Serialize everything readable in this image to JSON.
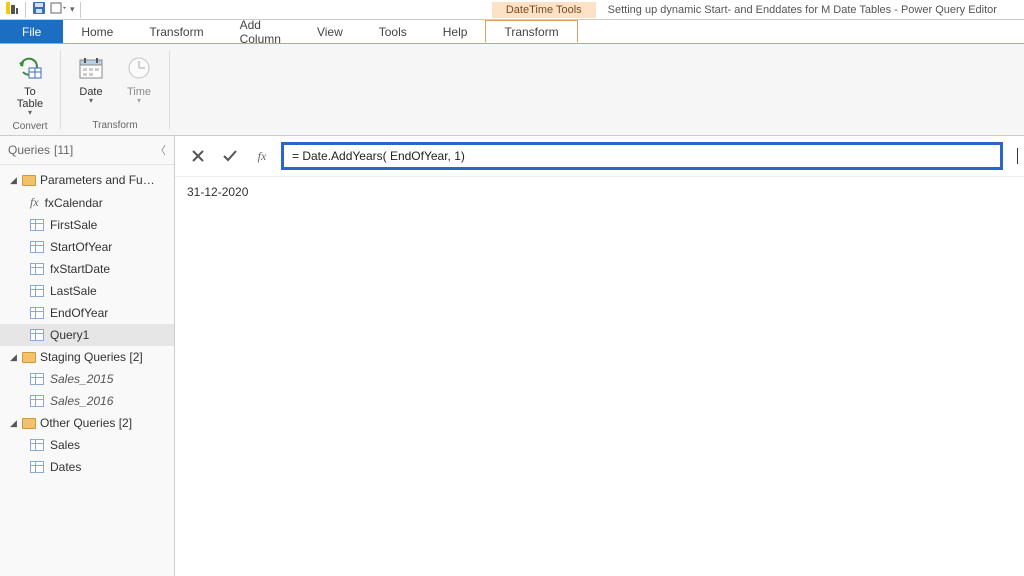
{
  "titlebar": {
    "context_label": "DateTime Tools",
    "document_title": "Setting up dynamic Start- and Enddates for M Date Tables - Power Query Editor"
  },
  "ribbon": {
    "tabs": {
      "file": "File",
      "home": "Home",
      "transform": "Transform",
      "add_column": "Add Column",
      "view": "View",
      "tools": "Tools",
      "help": "Help",
      "context_transform": "Transform"
    },
    "groups": {
      "convert": {
        "label": "Convert",
        "to_table": "To\nTable"
      },
      "transform": {
        "label": "Transform",
        "date": "Date",
        "time": "Time"
      }
    }
  },
  "queries": {
    "header": "Queries",
    "count": "[11]",
    "groups": [
      {
        "name": "Parameters and Fu…",
        "items": [
          {
            "label": "fxCalendar",
            "kind": "fx"
          },
          {
            "label": "FirstSale",
            "kind": "table"
          },
          {
            "label": "StartOfYear",
            "kind": "table"
          },
          {
            "label": "fxStartDate",
            "kind": "table"
          },
          {
            "label": "LastSale",
            "kind": "table"
          },
          {
            "label": "EndOfYear",
            "kind": "table"
          },
          {
            "label": "Query1",
            "kind": "table",
            "selected": true
          }
        ]
      },
      {
        "name": "Staging Queries [2]",
        "items": [
          {
            "label": "Sales_2015",
            "kind": "table",
            "italic": true
          },
          {
            "label": "Sales_2016",
            "kind": "table",
            "italic": true
          }
        ]
      },
      {
        "name": "Other Queries [2]",
        "items": [
          {
            "label": "Sales",
            "kind": "table"
          },
          {
            "label": "Dates",
            "kind": "table"
          }
        ]
      }
    ]
  },
  "formula": {
    "fx_label": "fx",
    "value": "= Date.AddYears( EndOfYear, 1)"
  },
  "result": {
    "value": "31-12-2020"
  }
}
